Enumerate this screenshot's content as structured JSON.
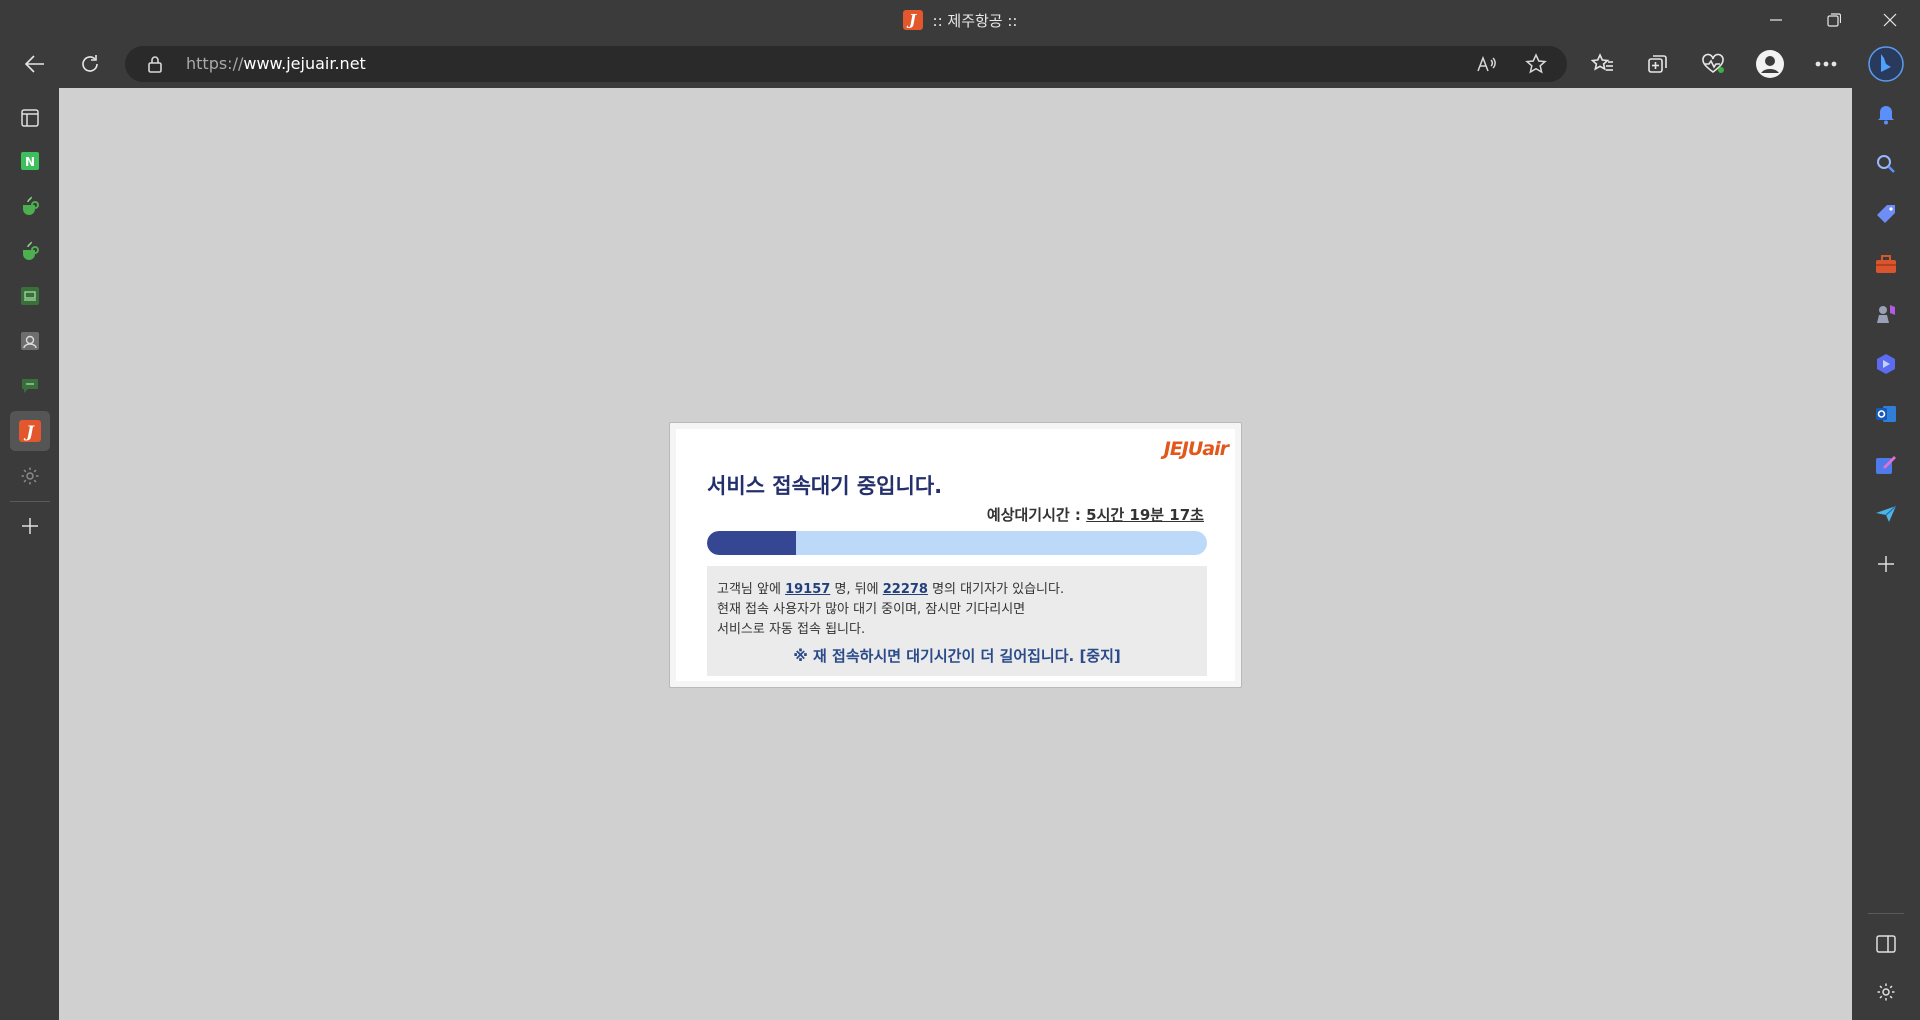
{
  "window": {
    "title": ":: 제주항공 ::",
    "favicon_glyph": "J"
  },
  "toolbar": {
    "url_protocol": "https://",
    "url_host": "www.jejuair.net"
  },
  "dialog": {
    "logo": "JEJUair",
    "title": "서비스 접속대기 중입니다.",
    "wait_label": "예상대기시간 : ",
    "wait_value": "5시간 19분 17초",
    "progress_fraction": 0.178,
    "info": {
      "line1_pre": "고객님 앞에 ",
      "ahead_count": "19157",
      "line1_mid": " 명, 뒤에 ",
      "behind_count": "22278",
      "line1_post": " 명의 대기자가 있습니다.",
      "line2": "현재 접속 사용자가 많아 대기 중이며, 잠시만 기다리시면",
      "line3": "서비스로 자동 접속 됩니다.",
      "warning": "※ 재 접속하시면 대기시간이 더 길어집니다. [중지]"
    }
  },
  "colors": {
    "chrome": "#3b3b3b",
    "page_bg": "#d1d0d1",
    "brand": "#e2571c",
    "title_blue": "#23306c",
    "progress_fill": "#354792",
    "progress_track": "#bcd9fa"
  },
  "left_sidebar": [
    "tab-actions-icon",
    "naver-icon",
    "jandi-icon",
    "jandi-icon-2",
    "remote-icon",
    "contacts-icon",
    "chat-icon",
    "jejuair-icon",
    "settings-icon",
    "add-icon"
  ],
  "right_sidebar": [
    "bell-icon",
    "search-icon",
    "tag-icon",
    "toolbox-icon",
    "games-icon",
    "copilot-icon",
    "outlook-icon",
    "designer-icon",
    "send-icon",
    "add-icon",
    "split-screen-icon",
    "settings-icon"
  ]
}
